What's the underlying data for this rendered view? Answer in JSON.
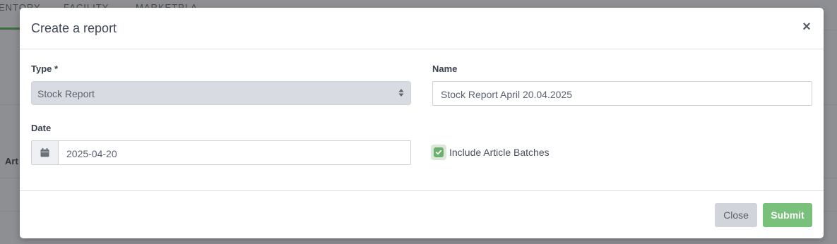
{
  "background": {
    "tabs": [
      "ENTORY",
      "FACILITY",
      "MARKETPLA"
    ],
    "column_header": "Art"
  },
  "modal": {
    "title": "Create a report",
    "close_icon": "×",
    "fields": {
      "type": {
        "label": "Type *",
        "value": "Stock Report"
      },
      "name": {
        "label": "Name",
        "value": "Stock Report April 20.04.2025"
      },
      "date": {
        "label": "Date",
        "value": "2025-04-20",
        "icon": "calendar-icon"
      },
      "include_batches": {
        "label": "Include Article Batches",
        "checked": true
      }
    },
    "footer": {
      "close_label": "Close",
      "submit_label": "Submit"
    }
  },
  "colors": {
    "accent_green": "#79c07a",
    "checkbox_green": "#6bb16b",
    "overlay": "#8e8f93"
  }
}
